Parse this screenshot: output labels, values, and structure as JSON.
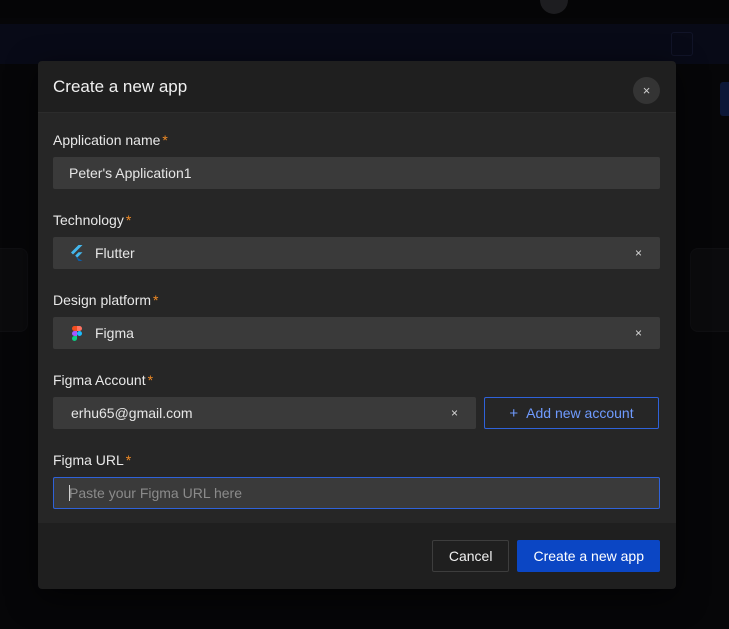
{
  "modal": {
    "title": "Create a new app",
    "close_glyph": "×"
  },
  "fields": {
    "application_name": {
      "label": "Application name",
      "required_mark": "*",
      "value": "Peter's Application1"
    },
    "technology": {
      "label": "Technology",
      "required_mark": "*",
      "value": "Flutter",
      "icon": "flutter-icon",
      "clear_glyph": "×"
    },
    "design_platform": {
      "label": "Design platform",
      "required_mark": "*",
      "value": "Figma",
      "icon": "figma-icon",
      "clear_glyph": "×"
    },
    "figma_account": {
      "label": "Figma Account",
      "required_mark": "*",
      "value": "erhu65@gmail.com",
      "clear_glyph": "×",
      "add_button_label": "Add new account",
      "add_glyph": "+"
    },
    "figma_url": {
      "label": "Figma URL",
      "required_mark": "*",
      "value": "",
      "placeholder": "Paste your Figma URL here"
    }
  },
  "footer": {
    "cancel_label": "Cancel",
    "submit_label": "Create a new app"
  },
  "colors": {
    "accent": "#0b46c4",
    "focus_border": "#2f62d9",
    "required": "#f08a24"
  }
}
